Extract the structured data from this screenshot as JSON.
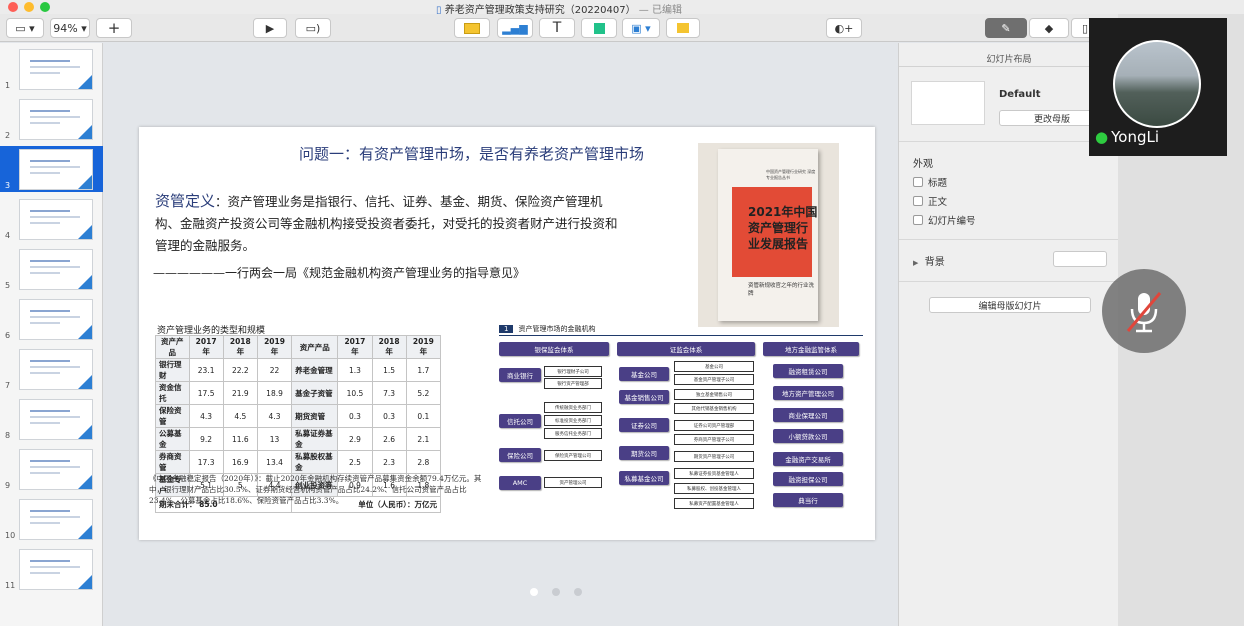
{
  "window": {
    "title": "养老资产管理政策支持研究（20220407）",
    "status": "— 已编辑",
    "colors": {
      "close": "#fe5f57",
      "minimize": "#febc2e",
      "zoom": "#28c840"
    }
  },
  "toolbar": {
    "zoom": "94%",
    "view_icon": "sidebar-view-icon",
    "add_icon": "plus-icon",
    "play_icon": "play-icon",
    "keynote_live_icon": "keynote-live-icon",
    "table_icon": "table-icon",
    "chart_icon": "chart-icon",
    "text_icon": "text-icon",
    "shape_icon": "shape-icon",
    "media_icon": "media-icon",
    "comment_icon": "comment-icon",
    "collaborate_icon": "collaborate-icon",
    "format_icon": "format-brush-icon",
    "animate_icon": "animate-diamond-icon",
    "document_icon": "document-icon"
  },
  "slides_panel": {
    "selected": 3,
    "slides": [
      "1",
      "2",
      "3",
      "4",
      "5",
      "6",
      "7",
      "8",
      "9",
      "10",
      "11"
    ]
  },
  "slide": {
    "title": "问题一：有资产管理市场，是否有养老资产管理市场",
    "def_label": "资管定义",
    "def_text": "：资产管理业务是指银行、信托、证券、基金、期货、保险资产管理机构、金融资产投资公司等金融机构接受投资者委托，对受托的投资者财产进行投资和管理的金融服务。",
    "quote": "——————一行两会一局《规范金融机构资产管理业务的指导意见》",
    "book": {
      "topline": "中国资产管理行业研究 深度专业报告丛书",
      "title": "2021年中国资产管理行业发展报告",
      "subtitle": "资管新规收官之年的行业洗牌"
    },
    "table": {
      "title": "资产管理业务的类型和规模",
      "headers": [
        "资产产品",
        "2017年",
        "2018年",
        "2019年",
        "资产产品",
        "2017年",
        "2018年",
        "2019年"
      ],
      "rows": [
        [
          "银行理财",
          "23.1",
          "22.2",
          "22",
          "养老金管理",
          "1.3",
          "1.5",
          "1.7"
        ],
        [
          "资金信托",
          "17.5",
          "21.9",
          "18.9",
          "基金子资管",
          "10.5",
          "7.3",
          "5.2"
        ],
        [
          "保险资管",
          "4.3",
          "4.5",
          "4.3",
          "期货资管",
          "0.3",
          "0.3",
          "0.1"
        ],
        [
          "公募基金",
          "9.2",
          "11.6",
          "13",
          "私募证券基金",
          "2.9",
          "2.6",
          "2.1"
        ],
        [
          "券商资管",
          "17.3",
          "16.9",
          "13.4",
          "私募股权基金",
          "2.5",
          "2.3",
          "2.8"
        ],
        [
          "基金专户",
          "5.1",
          "5",
          "4.4",
          "创业投资等",
          "0.9",
          "1.6",
          "1.8"
        ]
      ],
      "footer_left": "期末合计：  85.0",
      "footer_right": "单位（人民币）：万亿元"
    },
    "source": "《中国金融稳定报告（2020年）》：截止2020年金融机构存续资管产品募集资金余额79.4万亿元。其中，银行理财产品占比30.5%、证券期货经营机构资管产品占比24.2%、信托公司资管产品占比23.4%、公募基金占比18.6%、保险资管产品占比3.3%。",
    "org": {
      "num": "1",
      "title": "资产管理市场的金融机构",
      "heads": [
        "银保监会体系",
        "证监会体系",
        "地方金融监管体系"
      ],
      "bank_side": [
        "商业银行",
        "信托公司",
        "保险公司",
        "AMC"
      ],
      "bank_sub": [
        "银行理财子公司",
        "银行资产管理部",
        "传统融资业务部门",
        "标准投资业务部门",
        "服务信托业务部门",
        "保险资产管理公司",
        "资产管理公司"
      ],
      "sec_side": [
        "基金公司",
        "基金销售公司",
        "证券公司",
        "期货公司",
        "私募基金公司"
      ],
      "sec_sub": [
        "基金公司",
        "基金资产管理子公司",
        "独立基金销售公司",
        "其他代销基金销售机构",
        "证券公司资产管理部",
        "券商资产管理子公司",
        "期货资产管理子公司",
        "私募证券投资基金管理人",
        "私募股权、创投基金管理人",
        "私募资产配置基金管理人"
      ],
      "local": [
        "融资租赁公司",
        "地方资产管理公司",
        "商业保理公司",
        "小额贷款公司",
        "金融资产交易所",
        "融资担保公司",
        "典当行"
      ]
    },
    "nav_dots": [
      "1",
      "2",
      "3"
    ]
  },
  "inspector": {
    "tab": "幻灯片布局",
    "master_name": "Default",
    "change_master": "更改母版",
    "appearance": "外观",
    "options": [
      "标题",
      "正文",
      "幻灯片编号"
    ],
    "background": "背景",
    "edit_master": "编辑母版幻灯片"
  },
  "video": {
    "name": "YongLi"
  }
}
